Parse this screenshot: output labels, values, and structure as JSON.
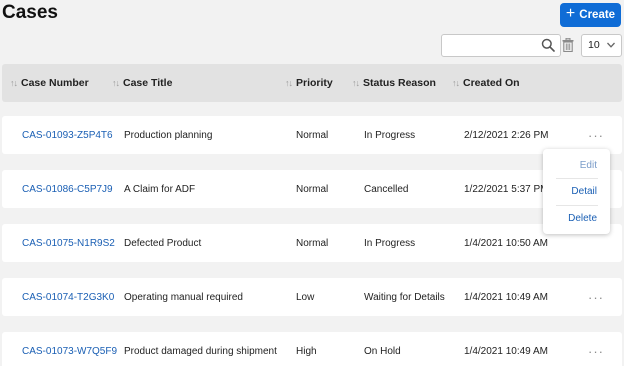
{
  "page": {
    "title": "Cases"
  },
  "toolbar": {
    "create_label": "Create",
    "search_value": "",
    "search_placeholder": "",
    "page_size": "10"
  },
  "table": {
    "columns": [
      "Case Number",
      "Case Title",
      "Priority",
      "Status Reason",
      "Created On"
    ],
    "rows": [
      {
        "number": "CAS-01093-Z5P4T6",
        "title": "Production planning",
        "priority": "Normal",
        "status": "In Progress",
        "created": "2/12/2021 2:26 PM"
      },
      {
        "number": "CAS-01086-C5P7J9",
        "title": "A Claim for ADF",
        "priority": "Normal",
        "status": "Cancelled",
        "created": "1/22/2021 5:37 PM"
      },
      {
        "number": "CAS-01075-N1R9S2",
        "title": "Defected Product",
        "priority": "Normal",
        "status": "In Progress",
        "created": "1/4/2021 10:50 AM"
      },
      {
        "number": "CAS-01074-T2G3K0",
        "title": "Operating manual required",
        "priority": "Low",
        "status": "Waiting for Details",
        "created": "1/4/2021 10:49 AM"
      },
      {
        "number": "CAS-01073-W7Q5F9",
        "title": "Product damaged during shipment",
        "priority": "High",
        "status": "On Hold",
        "created": "1/4/2021 10:49 AM"
      }
    ],
    "more_glyph": "···"
  },
  "context_menu": {
    "items": [
      "Edit",
      "Detail",
      "Delete"
    ]
  },
  "colors": {
    "accent": "#0f6cd6",
    "link": "#1a5fb4",
    "header_bg": "#e2e2e2",
    "page_bg": "#f2f2f2"
  }
}
